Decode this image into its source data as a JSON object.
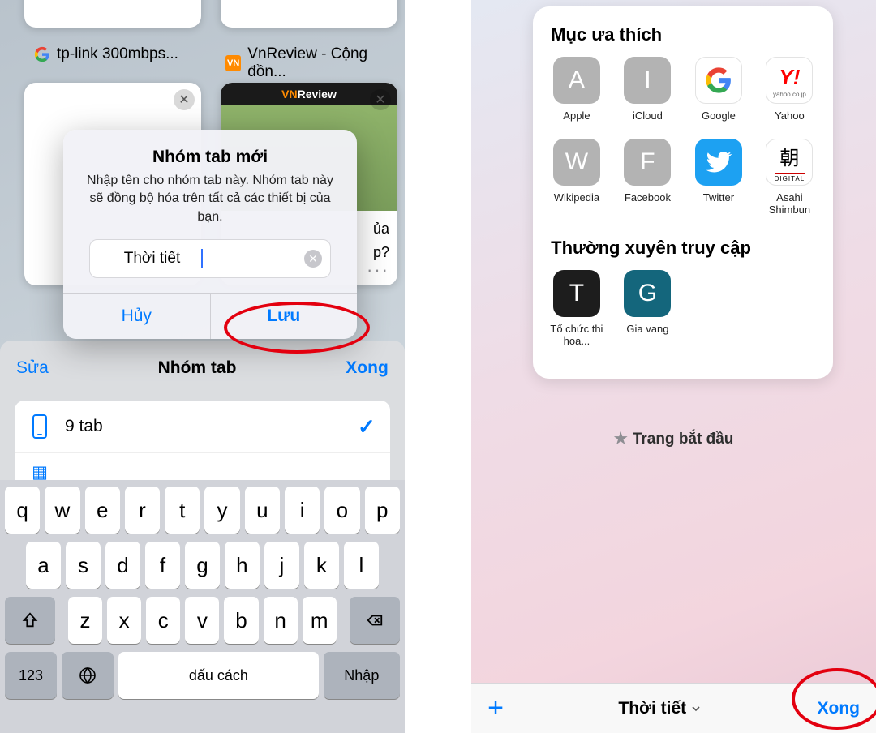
{
  "left": {
    "bg_tabs": {
      "t1_label": "tp-link 300mbps...",
      "t2_label": "VnReview - Cộng đồn...",
      "vn_prefix": "VN",
      "vn_suffix": "Review",
      "card_text1": "ủa",
      "card_text2": "p?"
    },
    "alert": {
      "title": "Nhóm tab mới",
      "message": "Nhập tên cho nhóm tab này. Nhóm tab này sẽ đồng bộ hóa trên tất cả các thiết bị của bạn.",
      "input_value": "Thời tiết",
      "cancel": "Hủy",
      "save": "Lưu"
    },
    "sheet": {
      "edit": "Sửa",
      "title": "Nhóm tab",
      "done": "Xong",
      "row1": "9 tab"
    },
    "keyboard": {
      "r1": [
        "q",
        "w",
        "e",
        "r",
        "t",
        "y",
        "u",
        "i",
        "o",
        "p"
      ],
      "r2": [
        "a",
        "s",
        "d",
        "f",
        "g",
        "h",
        "j",
        "k",
        "l"
      ],
      "r3": [
        "z",
        "x",
        "c",
        "v",
        "b",
        "n",
        "m"
      ],
      "k123": "123",
      "space": "dấu cách",
      "enter": "Nhập"
    }
  },
  "right": {
    "favorites_title": "Mục ưa thích",
    "favs": [
      {
        "letter": "A",
        "cls": "gray",
        "label": "Apple"
      },
      {
        "letter": "I",
        "cls": "gray",
        "label": "iCloud"
      },
      {
        "letter": "G",
        "cls": "white",
        "label": "Google"
      },
      {
        "letter": "Y!",
        "cls": "white",
        "label": "Yahoo"
      },
      {
        "letter": "W",
        "cls": "gray",
        "label": "Wikipedia"
      },
      {
        "letter": "F",
        "cls": "gray",
        "label": "Facebook"
      },
      {
        "letter": "",
        "cls": "tw",
        "label": "Twitter"
      },
      {
        "letter": "朝",
        "cls": "white",
        "label": "Asahi Shimbun"
      }
    ],
    "frequent_title": "Thường xuyên truy cập",
    "freq": [
      {
        "letter": "T",
        "cls": "dark",
        "label": "Tổ chức thi hoa..."
      },
      {
        "letter": "G",
        "cls": "teal",
        "label": "Gia vang"
      }
    ],
    "start_label": "Trang bắt đầu",
    "toolbar": {
      "title": "Thời tiết",
      "done": "Xong"
    },
    "asahi_sub": "DIGITAL",
    "yahoo_sub": "yahoo.co.jp"
  }
}
